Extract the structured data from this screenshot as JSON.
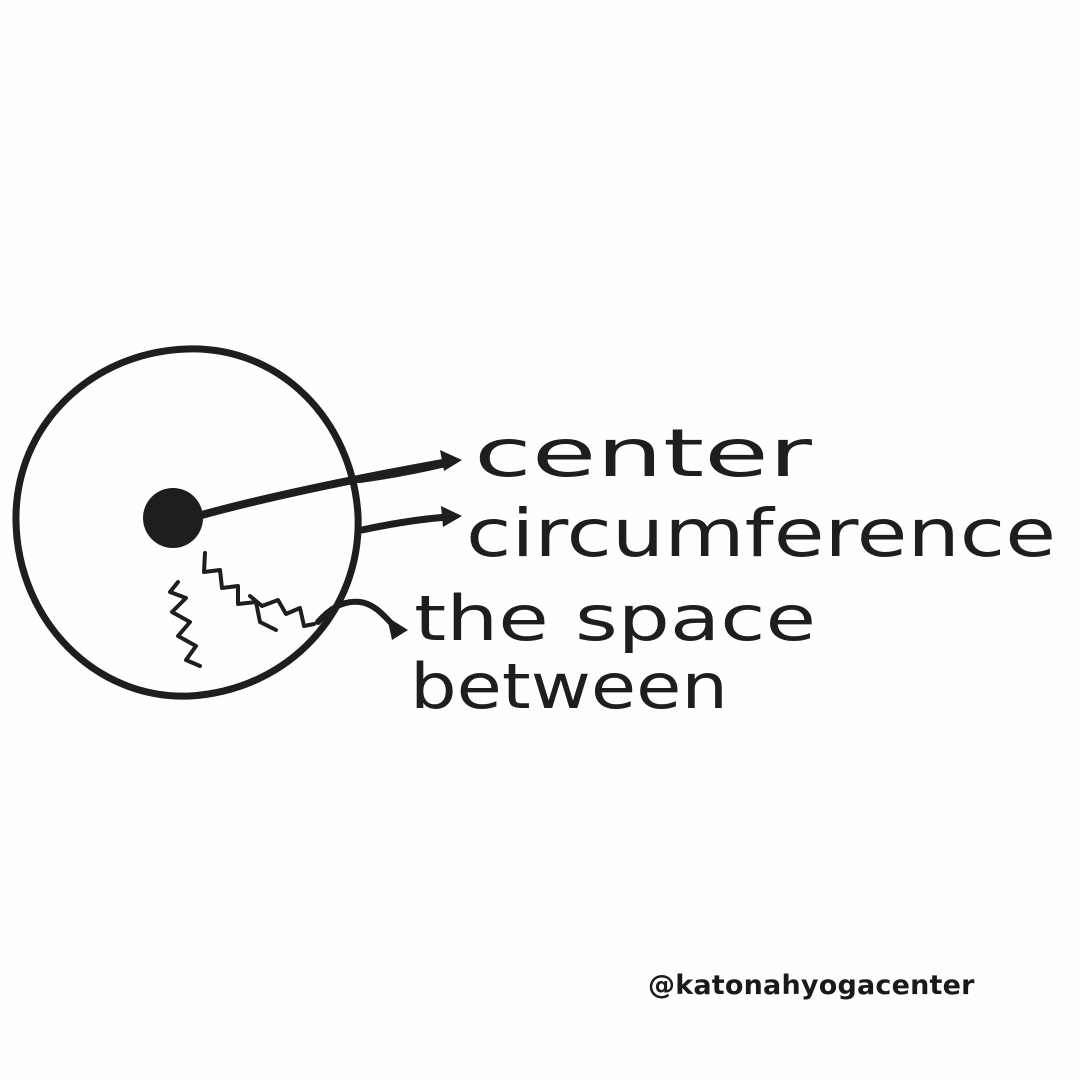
{
  "diagram": {
    "labels": {
      "center": "center",
      "circumference": "circumference",
      "space_line1": "the space",
      "space_line2": "between"
    }
  },
  "footer": {
    "handle": "@katonahyogacenter"
  },
  "colors": {
    "ink": "#1e1e1e",
    "background": "#fefefe"
  }
}
